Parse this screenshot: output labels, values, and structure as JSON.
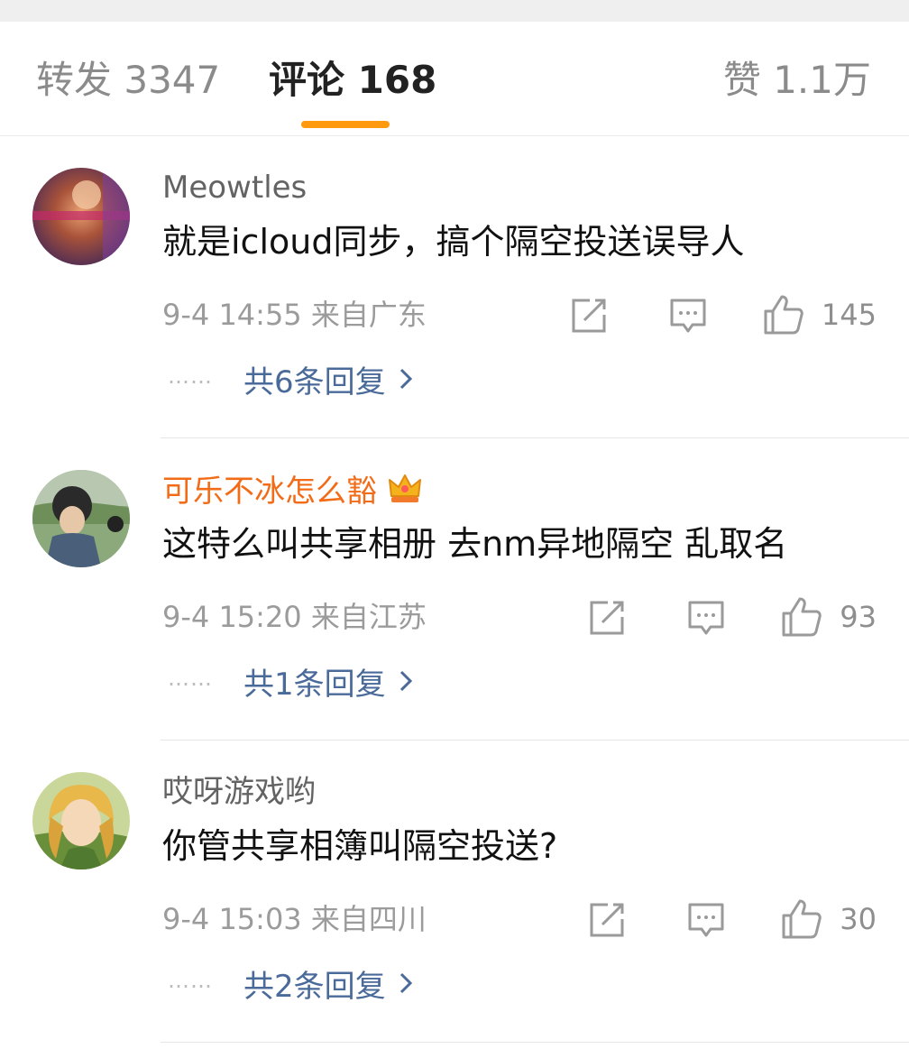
{
  "tabs": {
    "repost": "转发 3347",
    "comment": "评论 168",
    "like": "赞 1.1万"
  },
  "colors": {
    "accent_indicator": "#ff9a0e",
    "vip_name": "#f26c18",
    "reply_link": "#4a6a9a",
    "meta_text": "#9b9b9b"
  },
  "comments": [
    {
      "user": "Meowtles",
      "vip": false,
      "text": "就是icloud同步，搞个隔空投送误导人",
      "time_location": "9-4 14:55 来自广东",
      "likes": "145",
      "dots": "……",
      "replies": "共6条回复"
    },
    {
      "user": "可乐不冰怎么豁",
      "vip": true,
      "text": "这特么叫共享相册 去nm异地隔空 乱取名",
      "time_location": "9-4 15:20 来自江苏",
      "likes": "93",
      "dots": "……",
      "replies": "共1条回复"
    },
    {
      "user": "哎呀游戏哟",
      "vip": false,
      "text": "你管共享相簿叫隔空投送?",
      "time_location": "9-4 15:03 来自四川",
      "likes": "30",
      "dots": "……",
      "replies": "共2条回复"
    }
  ],
  "icons": {
    "share": "share-icon",
    "reply": "comment-icon",
    "like": "thumbs-up-icon",
    "chevron": "chevron-right-icon",
    "vip": "crown-icon"
  }
}
